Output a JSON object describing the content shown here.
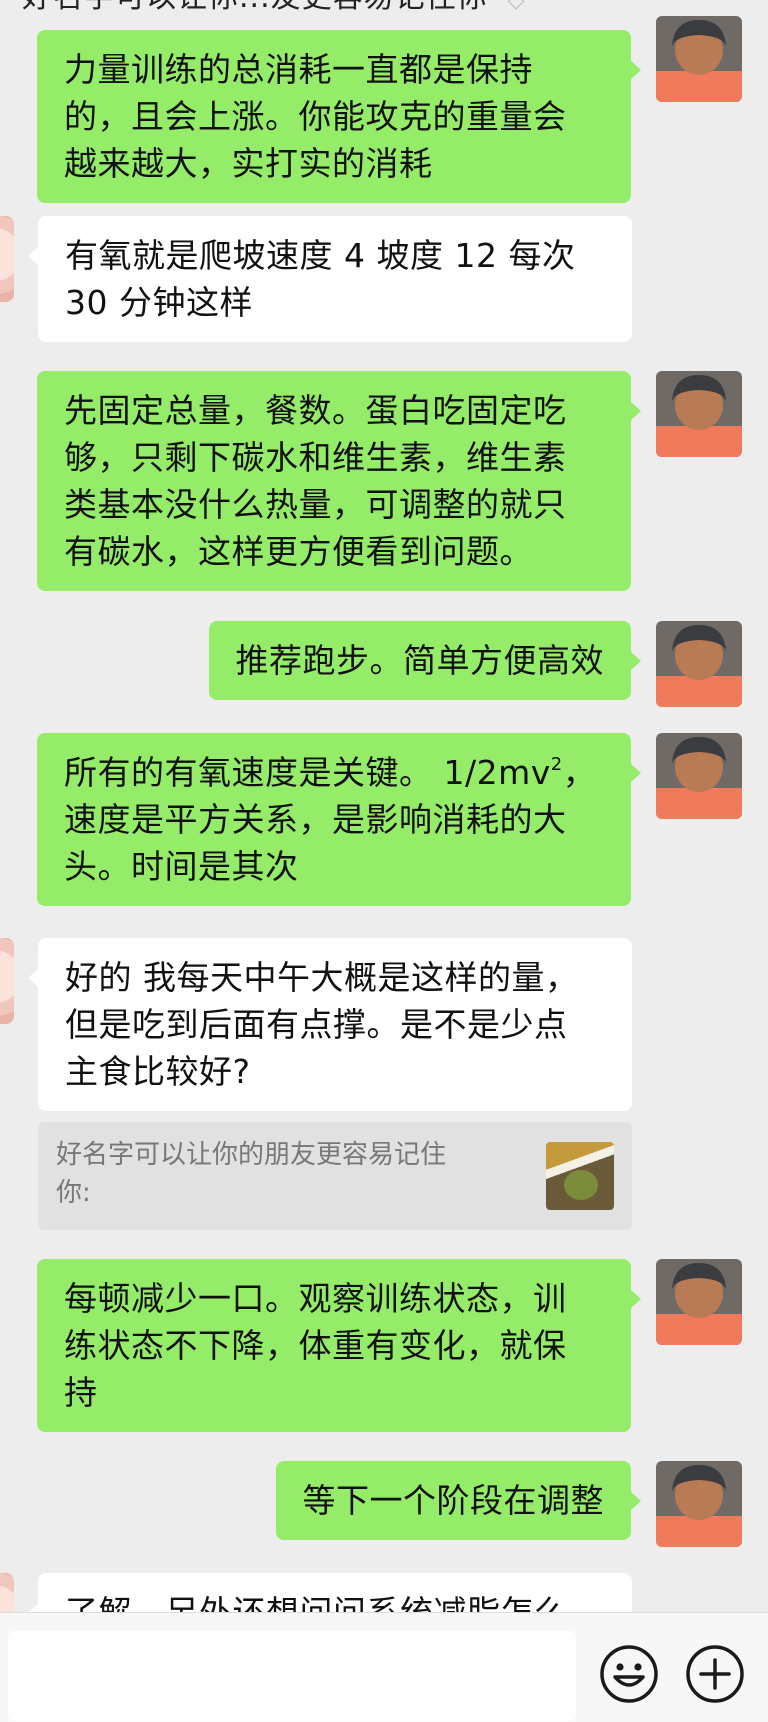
{
  "header": {
    "title_partial": "好名字可以让你...友更容易记住你"
  },
  "messages": [
    {
      "side": "right",
      "lines": [
        "力量训练的总消耗一直都是保持",
        "的，且会上涨。你能攻克的重量会",
        "越来越大，实打实的消耗"
      ]
    },
    {
      "side": "left",
      "lines": [
        "有氧就是爬坡速度 4 坡度 12 每次",
        "30 分钟这样"
      ]
    },
    {
      "side": "right",
      "lines": [
        "先固定总量，餐数。蛋白吃固定吃",
        "够，只剩下碳水和维生素，维生素",
        "类基本没什么热量，可调整的就只",
        "有碳水，这样更方便看到问题。"
      ]
    },
    {
      "side": "right",
      "lines": [
        "推荐跑步。简单方便高效"
      ]
    },
    {
      "side": "right",
      "line1_prefix": "所有的有氧速度是关键。 1/2mv",
      "line1_sup": "2",
      "line1_suffix": "，",
      "lines": [
        "速度是平方关系，是影响消耗的大",
        "头。时间是其次"
      ]
    },
    {
      "side": "left",
      "lines": [
        "好的 我每天中午大概是这样的量，",
        "但是吃到后面有点撑。是不是少点",
        "主食比较好?"
      ]
    },
    {
      "side": "right",
      "lines": [
        "每顿减少一口。观察训练状态，训",
        "练状态不下降，体重有变化，就保",
        "持"
      ]
    },
    {
      "side": "right",
      "lines": [
        "等下一个阶段在调整"
      ]
    },
    {
      "side": "left",
      "lines": [
        "了解，另外还想问问系统减脂怎么"
      ]
    }
  ],
  "quote": {
    "lines": [
      "好名字可以让你的朋友更容易记住",
      "你:"
    ]
  },
  "footer": {
    "input_value": "",
    "emoji_icon": "smiley-face-icon",
    "plus_icon": "plus-circle-icon"
  },
  "colors": {
    "sent_bubble": "#95ec69",
    "received_bubble": "#ffffff",
    "background": "#ededed"
  }
}
